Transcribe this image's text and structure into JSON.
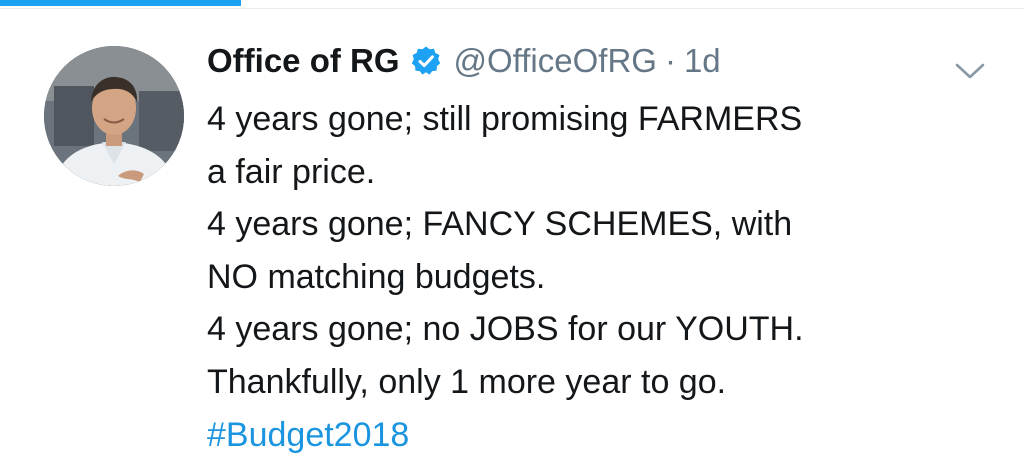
{
  "top_bar": {
    "progress_fraction": 0.235,
    "accent_color": "#1da1f2"
  },
  "tweet": {
    "avatar_icon": "profile-photo",
    "display_name": "Office of RG",
    "verified_icon": "verified-badge-icon",
    "handle": "@OfficeOfRG",
    "separator": "·",
    "time": "1d",
    "menu_icon": "chevron-down-icon",
    "text_lines": [
      "4 years gone; still promising FARMERS",
      "a fair price.",
      "4 years gone; FANCY SCHEMES, with",
      "NO matching budgets.",
      "4 years gone; no JOBS for our YOUTH.",
      "Thankfully, only 1 more year to go."
    ],
    "hashtag": "#Budget2018",
    "colors": {
      "text": "#14171a",
      "secondary": "#657786",
      "link": "#1b95e0",
      "verified": "#1da1f2"
    }
  }
}
